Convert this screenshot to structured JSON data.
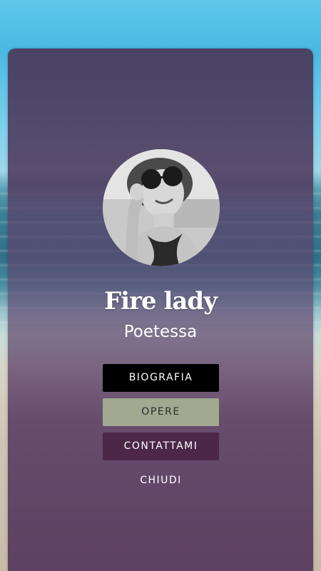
{
  "profile": {
    "name": "Fire lady",
    "role": "Poetessa"
  },
  "menu": {
    "biografia": "BIOGRAFIA",
    "opere": "OPERE",
    "contattami": "CONTATTAMI",
    "chiudi": "CHIUDI"
  },
  "colors": {
    "card_overlay": "#4f3a5e",
    "biografia_bg": "#000000",
    "opere_bg": "#a2a990",
    "contattami_bg": "#4c2748",
    "text": "#ffffff"
  },
  "background": {
    "scene": "beach-sea-sky"
  }
}
